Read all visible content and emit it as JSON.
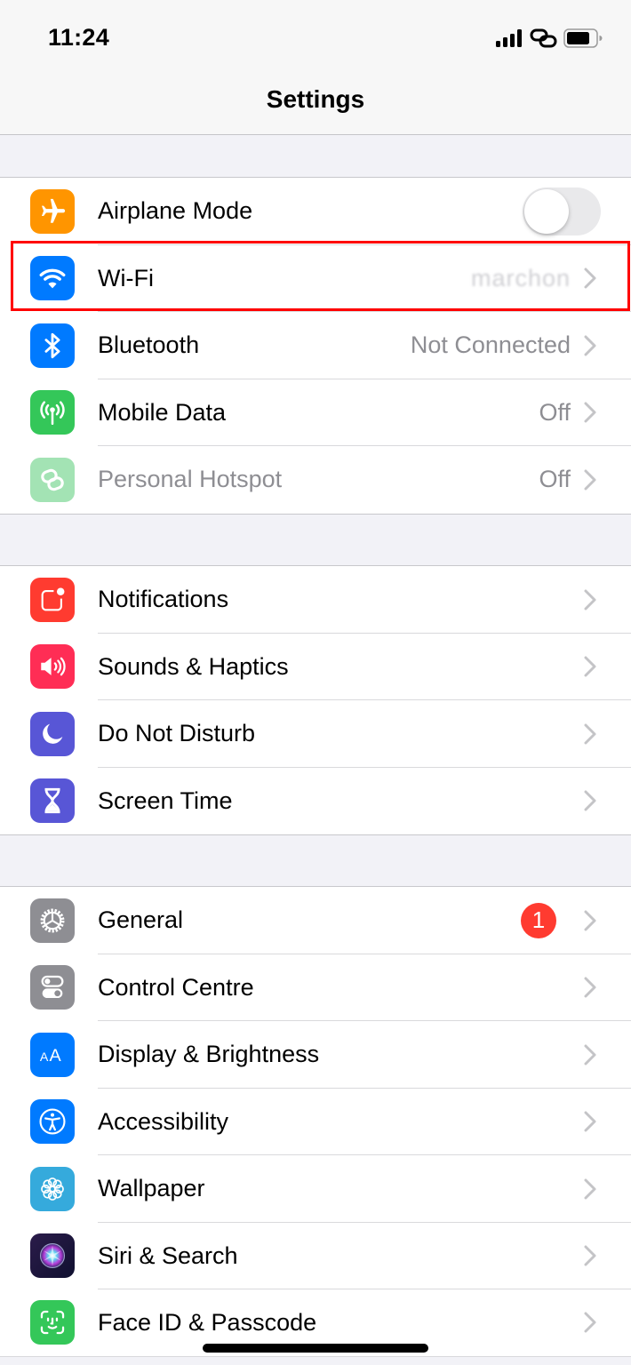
{
  "status_bar": {
    "time": "11:24",
    "icons": [
      "cellular-signal-icon",
      "personal-hotspot-link-icon",
      "battery-icon"
    ]
  },
  "header": {
    "title": "Settings"
  },
  "groups": [
    {
      "rows": [
        {
          "label": "Airplane Mode",
          "icon": "airplane-icon",
          "icon_color": "#ff9500",
          "control": "toggle",
          "toggle_on": false
        },
        {
          "label": "Wi-Fi",
          "icon": "wifi-icon",
          "icon_color": "#007aff",
          "value": "marchon",
          "value_obscured": true,
          "highlighted": true
        },
        {
          "label": "Bluetooth",
          "icon": "bluetooth-icon",
          "icon_color": "#007aff",
          "value": "Not Connected"
        },
        {
          "label": "Mobile Data",
          "icon": "antenna-icon",
          "icon_color": "#34c759",
          "value": "Off"
        },
        {
          "label": "Personal Hotspot",
          "icon": "hotspot-icon",
          "icon_color": "#a3e3b4",
          "value": "Off",
          "disabled": true
        }
      ]
    },
    {
      "rows": [
        {
          "label": "Notifications",
          "icon": "notifications-icon",
          "icon_color": "#ff3b30"
        },
        {
          "label": "Sounds & Haptics",
          "icon": "speaker-icon",
          "icon_color": "#ff2d55"
        },
        {
          "label": "Do Not Disturb",
          "icon": "moon-icon",
          "icon_color": "#5856d6"
        },
        {
          "label": "Screen Time",
          "icon": "hourglass-icon",
          "icon_color": "#5856d6"
        }
      ]
    },
    {
      "rows": [
        {
          "label": "General",
          "icon": "gear-icon",
          "icon_color": "#8e8e93",
          "badge": "1"
        },
        {
          "label": "Control Centre",
          "icon": "switches-icon",
          "icon_color": "#8e8e93"
        },
        {
          "label": "Display & Brightness",
          "icon": "text-size-icon",
          "icon_color": "#007aff"
        },
        {
          "label": "Accessibility",
          "icon": "accessibility-icon",
          "icon_color": "#007aff"
        },
        {
          "label": "Wallpaper",
          "icon": "flower-icon",
          "icon_color": "#35aadc"
        },
        {
          "label": "Siri & Search",
          "icon": "siri-icon",
          "icon_color": "#1c1c3a"
        },
        {
          "label": "Face ID & Passcode",
          "icon": "face-id-icon",
          "icon_color": "#34c759"
        }
      ]
    }
  ],
  "colors": {
    "highlight_border": "#ff0000",
    "chevron": "#c4c4c7",
    "badge": "#ff3b30"
  }
}
